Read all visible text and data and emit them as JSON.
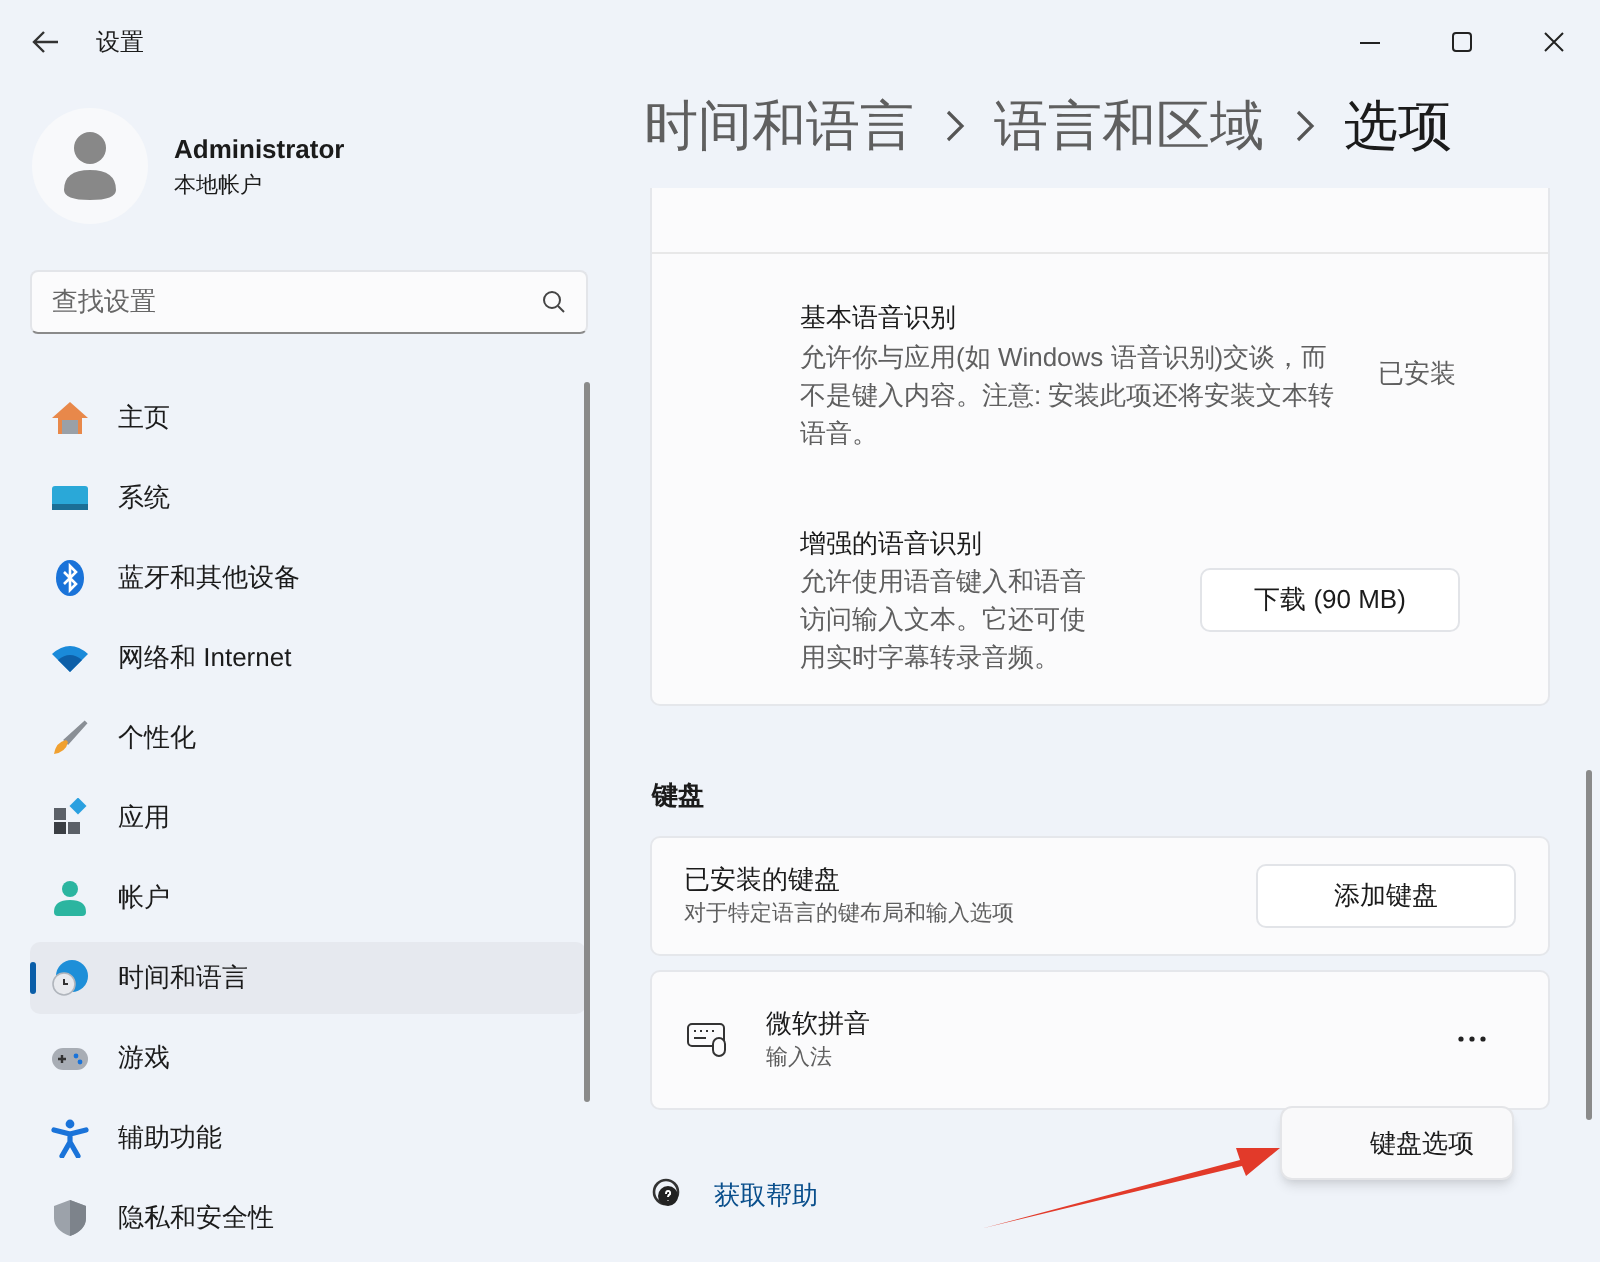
{
  "window": {
    "title": "设置"
  },
  "user": {
    "name": "Administrator",
    "account_type": "本地帐户"
  },
  "search": {
    "placeholder": "查找设置"
  },
  "nav": [
    {
      "label": "主页",
      "kind": "home",
      "selected": false
    },
    {
      "label": "系统",
      "kind": "system",
      "selected": false
    },
    {
      "label": "蓝牙和其他设备",
      "kind": "bluetooth",
      "selected": false
    },
    {
      "label": "网络和 Internet",
      "kind": "network",
      "selected": false
    },
    {
      "label": "个性化",
      "kind": "brush",
      "selected": false
    },
    {
      "label": "应用",
      "kind": "apps",
      "selected": false
    },
    {
      "label": "帐户",
      "kind": "account",
      "selected": false
    },
    {
      "label": "时间和语言",
      "kind": "time",
      "selected": true
    },
    {
      "label": "游戏",
      "kind": "game",
      "selected": false
    },
    {
      "label": "辅助功能",
      "kind": "accessibility",
      "selected": false
    },
    {
      "label": "隐私和安全性",
      "kind": "shield",
      "selected": false
    }
  ],
  "breadcrumb": [
    "时间和语言",
    "语言和区域",
    "选项"
  ],
  "speech_items": [
    {
      "title": "基本语音识别",
      "description": "允许你与应用(如 Windows 语音识别)交谈，而不是键入内容。注意: 安装此项还将安装文本转语音。",
      "kind": "status",
      "action": "已安装"
    },
    {
      "title": "增强的语音识别",
      "description": "允许使用语音键入和语音访问输入文本。它还可使用实时字幕转录音频。",
      "kind": "button",
      "action": "下载 (90 MB)"
    }
  ],
  "keyboard": {
    "heading": "键盘",
    "installed": {
      "title": "已安装的键盘",
      "description": "对于特定语言的键布局和输入选项",
      "button": "添加键盘"
    },
    "keyboards": [
      {
        "name": "微软拼音",
        "type": "输入法"
      }
    ]
  },
  "menu": {
    "items": [
      "键盘选项"
    ]
  },
  "help_link": "获取帮助"
}
